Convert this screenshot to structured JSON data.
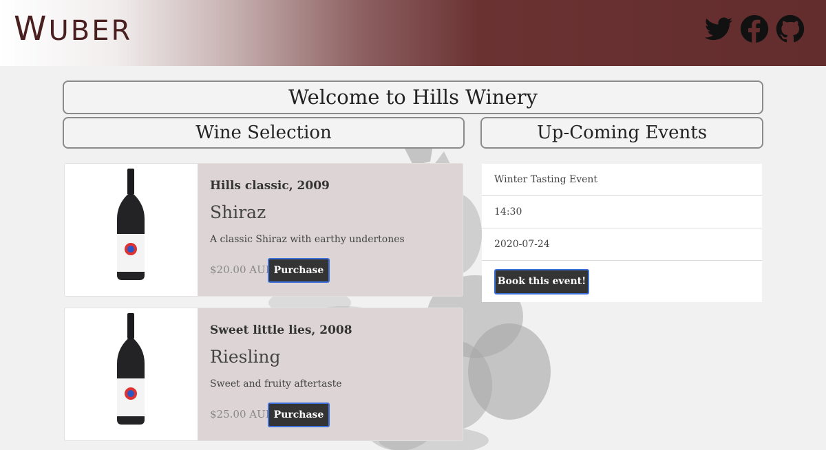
{
  "header": {
    "logo_first": "W",
    "logo_rest": "UBER",
    "social": [
      "twitter-icon",
      "facebook-icon",
      "github-icon"
    ]
  },
  "welcome": "Welcome to Hills Winery",
  "wine_section_title": "Wine Selection",
  "events_section_title": "Up-Coming Events",
  "wines": [
    {
      "vintage": "Hills classic, 2009",
      "varietal": "Shiraz",
      "description": "A classic Shiraz with earthy undertones",
      "price": "$20.00 AUD",
      "button": "Purchase"
    },
    {
      "vintage": "Sweet little lies, 2008",
      "varietal": "Riesling",
      "description": "Sweet and fruity aftertaste",
      "price": "$25.00 AUD",
      "button": "Purchase"
    }
  ],
  "event": {
    "name": "Winter Tasting Event",
    "time": "14:30",
    "date": "2020-07-24",
    "button": "Book this event!"
  },
  "colors": {
    "header_dark": "#632d2d",
    "card_info_bg": "#ddd5d5",
    "button_bg": "#343434",
    "button_border": "#3c6fd8"
  }
}
